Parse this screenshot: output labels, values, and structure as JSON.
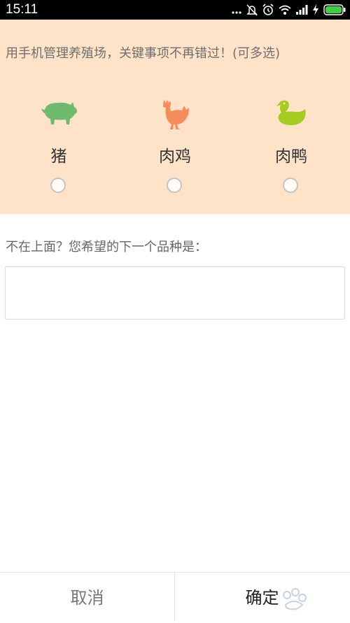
{
  "status_bar": {
    "time": "15:11",
    "icons": [
      "dots-icon",
      "mute-icon",
      "alarm-icon",
      "wifi-icon",
      "signal-icon",
      "charging-icon",
      "battery-icon"
    ],
    "battery_color": "#3ed13e"
  },
  "panel": {
    "background": "#ffe3c8",
    "headline": "用手机管理养殖场，关键事项不再错过！(可多选)",
    "options": [
      {
        "label": "猪",
        "icon": "pig-icon",
        "color": "#6fba6f",
        "selected": false
      },
      {
        "label": "肉鸡",
        "icon": "chicken-icon",
        "color": "#f58c5a",
        "selected": false
      },
      {
        "label": "肉鸭",
        "icon": "duck-icon",
        "color": "#a6cc1f",
        "selected": false
      }
    ]
  },
  "suggestion": {
    "question": "不在上面？您希望的下一个品种是：",
    "input_value": "",
    "input_placeholder": ""
  },
  "buttons": {
    "cancel": "取消",
    "confirm": "确定"
  }
}
